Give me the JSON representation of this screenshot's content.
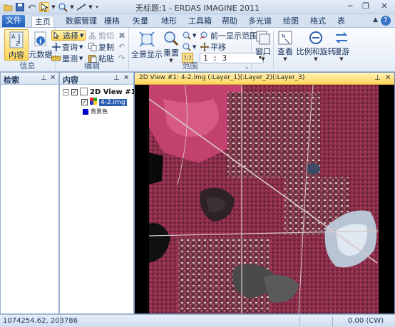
{
  "window": {
    "title": "无标题:1 - ERDAS IMAGINE 2011"
  },
  "tabs": [
    "文件",
    "主页",
    "数据管理",
    "栅格",
    "矢量",
    "地形",
    "工具箱",
    "帮助",
    "多光谱",
    "绘图",
    "格式",
    "表"
  ],
  "active_tab": "主页",
  "ribbon": {
    "info_group": {
      "label": "信息",
      "content_btn": "内容",
      "metadata_btn": "元数据"
    },
    "edit_group": {
      "label": "编辑",
      "select": "选择",
      "query": "查询",
      "measure": "量测",
      "cut": "剪切",
      "copy": "复制",
      "paste": "粘贴"
    },
    "extent_group": {
      "label": "范围",
      "fit_btn": "全景显示",
      "reset_btn": "重置",
      "prev_extent": "前一显示范围",
      "pan": "平移",
      "scale_value": "1 : 3"
    },
    "window_btn": "窗口",
    "view_btn": "查看",
    "scale_rotate_btn": "比例和旋转",
    "roam_btn": "漫游"
  },
  "panels": {
    "retrieve": {
      "title": "检索"
    },
    "contents": {
      "title": "内容",
      "view_name": "2D View #1",
      "layer_name": "4-2.img",
      "background": "背景色"
    }
  },
  "view": {
    "title": "2D View #1: 4-2.img (:Layer_1)(:Layer_2)(:Layer_3)"
  },
  "status": {
    "coords": "1074254.62, 203786",
    "rotation": "0.00 (CW)"
  },
  "colors": {
    "accent": "#1e5bb8",
    "active_view_header": "#ffd35a",
    "vegetation": "#c2416f"
  }
}
